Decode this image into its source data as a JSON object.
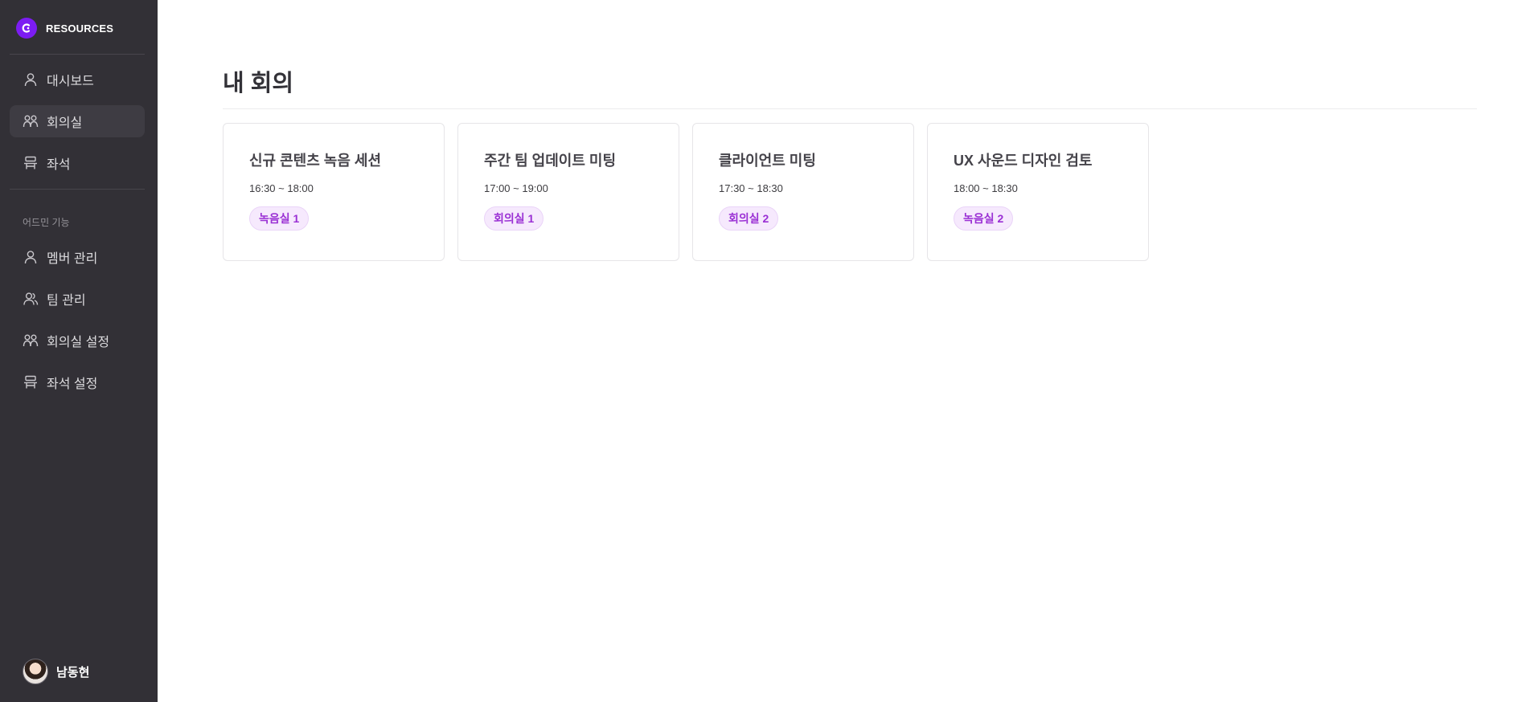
{
  "brand": {
    "name": "RESOURCES",
    "accent": "#7c1cf2"
  },
  "nav": {
    "items": [
      {
        "label": "대시보드",
        "icon": "person-icon"
      },
      {
        "label": "회의실",
        "icon": "people-icon",
        "active": true
      },
      {
        "label": "좌석",
        "icon": "seat-icon"
      }
    ]
  },
  "admin": {
    "section_label": "어드민 기능",
    "items": [
      {
        "label": "멤버 관리",
        "icon": "person-icon"
      },
      {
        "label": "팀 관리",
        "icon": "team-icon"
      },
      {
        "label": "회의실 설정",
        "icon": "people-icon"
      },
      {
        "label": "좌석 설정",
        "icon": "seat-icon"
      }
    ]
  },
  "user": {
    "name": "남동현"
  },
  "main": {
    "title": "내 회의",
    "meetings": [
      {
        "title": "신규 콘텐츠 녹음 세션",
        "time": "16:30 ~ 18:00",
        "room": "녹음실 1"
      },
      {
        "title": "주간 팀 업데이트 미팅",
        "time": "17:00 ~ 19:00",
        "room": "회의실 1"
      },
      {
        "title": "클라이언트 미팅",
        "time": "17:30 ~ 18:30",
        "room": "회의실 2"
      },
      {
        "title": "UX 사운드 디자인 검토",
        "time": "18:00 ~ 18:30",
        "room": "녹음실 2"
      }
    ]
  }
}
